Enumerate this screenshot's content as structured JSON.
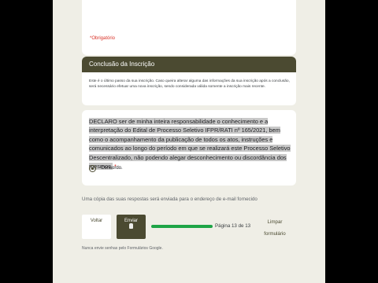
{
  "form": {
    "required_note": "*Obrigatório",
    "section": {
      "title": "Conclusão da Inscrição",
      "description": "Este é o último passo da sua inscrição. Caso queira alterar alguma das informações da sua inscrição após a conclusão, será necessário efetuar uma nova inscrição, sendo considerada válida somente a inscrição mais recente."
    },
    "question": {
      "text": "DECLARO ser de minha inteira responsabilidade o conhecimento e a interpretação do Edital de Processo Seletivo IFPR/RATI nº 165/2021, bem como o acompanhamento da publicação de todos os atos, instruções e comunicados ao longo do período em que se realizará este Processo Seletivo Descentralizado, não podendo alegar desconhecimento ou discordância dos mesmos.",
      "required_star": "*",
      "option_label": "Concordo.",
      "option_selected": true
    },
    "copy_note": "Uma cópia das suas respostas será enviada para o endereço de e-mail fornecido",
    "buttons": {
      "back": "Voltar",
      "send": "Enviar",
      "clear": "Limpar formulário"
    },
    "progress": {
      "label": "Página 13 de 13",
      "fraction": 1.0
    },
    "footer_note": "Nunca envie senhas pelo Formulários Google."
  },
  "colors": {
    "accent": "#4b4a31",
    "progress": "#1ea446",
    "required": "#d93025",
    "background": "#efeee6"
  }
}
